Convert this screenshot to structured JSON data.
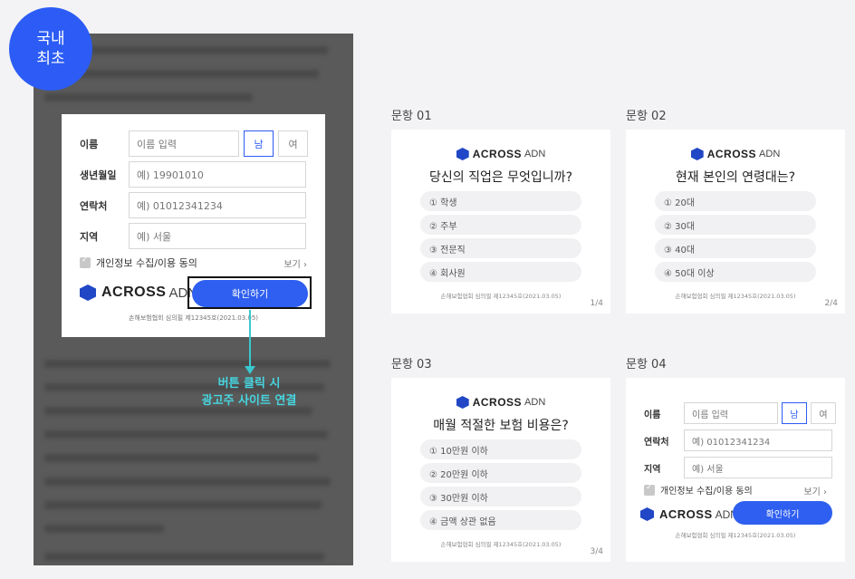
{
  "badge": {
    "text": "국내\n최초"
  },
  "form": {
    "name_label": "이름",
    "name_placeholder": "이름 입력",
    "gender_male": "남",
    "gender_female": "여",
    "birth_label": "생년월일",
    "birth_placeholder": "예) 19901010",
    "phone_label": "연락처",
    "phone_placeholder": "예) 01012341234",
    "region_label": "지역",
    "region_placeholder": "예) 서울",
    "agree_label": "개인정보 수집/이용 동의",
    "view_label": "보기 ›",
    "brand_main": "ACROSS",
    "brand_sub": "ADN",
    "confirm_label": "확인하기",
    "note": "손해보험협회 심의필 제12345호(2021.03.05)"
  },
  "callout": {
    "text": "버튼 클릭 시\n광고주 사이트 연결"
  },
  "questions": [
    {
      "title": "문항 01",
      "question": "당신의 직업은 무엇입니까?",
      "options": [
        "① 학생",
        "② 주부",
        "③ 전문직",
        "④ 회사원"
      ],
      "note": "손해보험협회 심의필 제12345호(2021.03.05)",
      "page": "1/4"
    },
    {
      "title": "문항 02",
      "question": "현재 본인의 연령대는?",
      "options": [
        "① 20대",
        "② 30대",
        "③ 40대",
        "④ 50대 이상"
      ],
      "note": "손해보험협회 심의필 제12345호(2021.03.05)",
      "page": "2/4"
    },
    {
      "title": "문항 03",
      "question": "매월 적절한 보험 비용은?",
      "options": [
        "① 10만원 이하",
        "② 20만원 이하",
        "③ 30만원 이하",
        "④ 금액 상관 없음"
      ],
      "note": "손해보험협회 심의필 제12345호(2021.03.05)",
      "page": "3/4"
    }
  ],
  "q4": {
    "title": "문항 04",
    "name_label": "이름",
    "name_placeholder": "이름 입력",
    "gender_male": "남",
    "gender_female": "여",
    "phone_label": "연락처",
    "phone_placeholder": "예) 01012341234",
    "region_label": "지역",
    "region_placeholder": "예) 서울",
    "agree_label": "개인정보 수집/이용 동의",
    "view_label": "보기 ›",
    "brand_main": "ACROSS",
    "brand_sub": "ADN",
    "confirm_label": "확인하기",
    "note": "손해보험협회 심의필 제12345호(2021.03.05)"
  },
  "colors": {
    "accent": "#2f5ff0",
    "badge": "#2c5cf5",
    "callout": "#46d6e0",
    "panel": "#5a5a5a"
  }
}
